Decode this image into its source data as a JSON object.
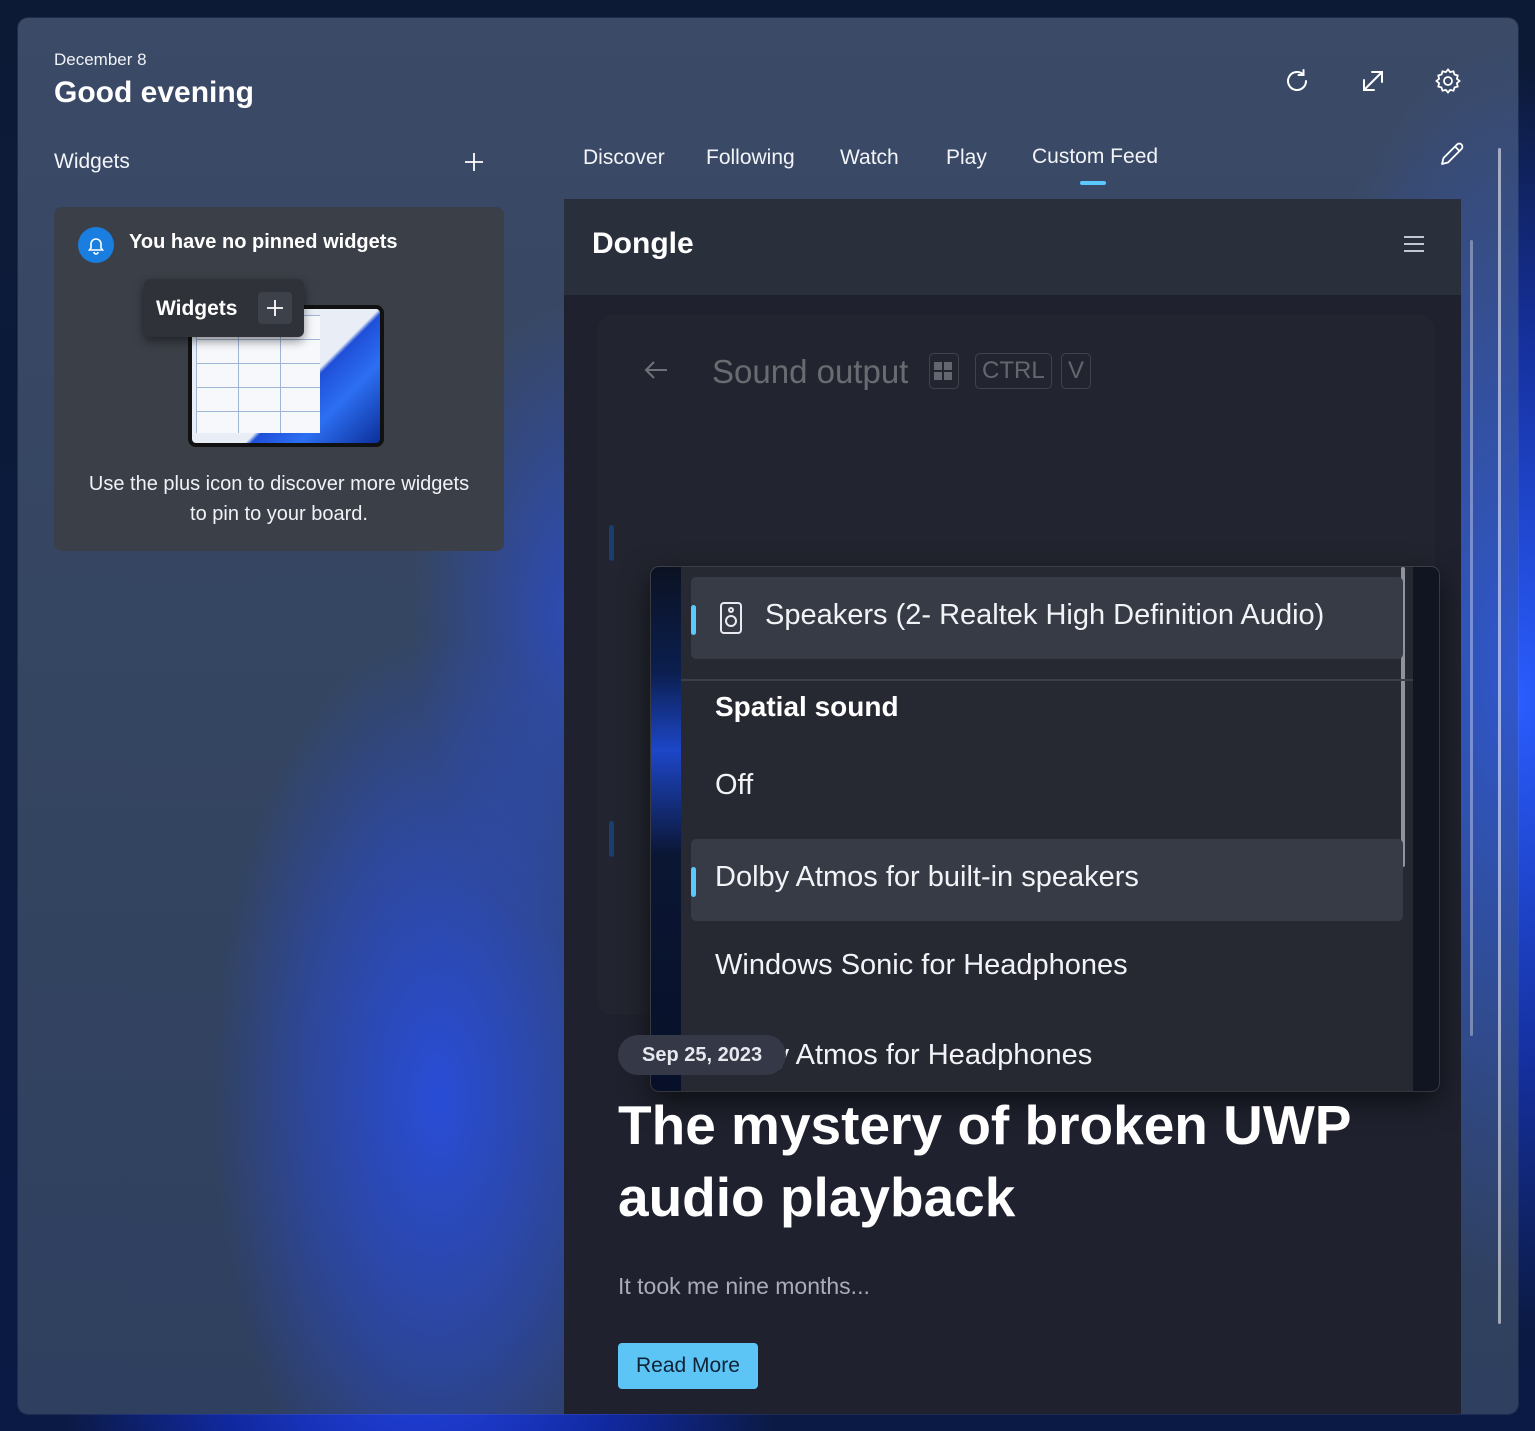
{
  "header": {
    "date": "December 8",
    "greeting": "Good evening"
  },
  "toolbar": {
    "icons": [
      "refresh-icon",
      "expand-icon",
      "settings-icon"
    ]
  },
  "widgets": {
    "label": "Widgets",
    "empty_title": "You have no pinned widgets",
    "illustration_label": "Widgets",
    "description": "Use the plus icon to discover more widgets to pin to your board."
  },
  "tabs": [
    {
      "label": "Discover"
    },
    {
      "label": "Following"
    },
    {
      "label": "Watch"
    },
    {
      "label": "Play"
    },
    {
      "label": "Custom Feed",
      "active": true
    }
  ],
  "feed": {
    "title": "Dongle",
    "screenshot": {
      "heading": "Sound output",
      "keys": [
        "CTRL",
        "V"
      ],
      "device": "Speakers (2- Realtek High Definition Audio)",
      "section": "Spatial sound",
      "options": [
        "Off",
        "Dolby Atmos for built-in speakers",
        "Windows Sonic for Headphones",
        "Dolby Atmos for Headphones"
      ],
      "selected_option": "Dolby Atmos for built-in speakers"
    },
    "post": {
      "date": "Sep 25, 2023",
      "title": "The mystery of broken UWP audio playback",
      "excerpt": "It took me nine months...",
      "button": "Read More"
    }
  },
  "colors": {
    "accent": "#5bc8ff",
    "button": "#5dc5f5",
    "bell": "#1a7de0"
  }
}
